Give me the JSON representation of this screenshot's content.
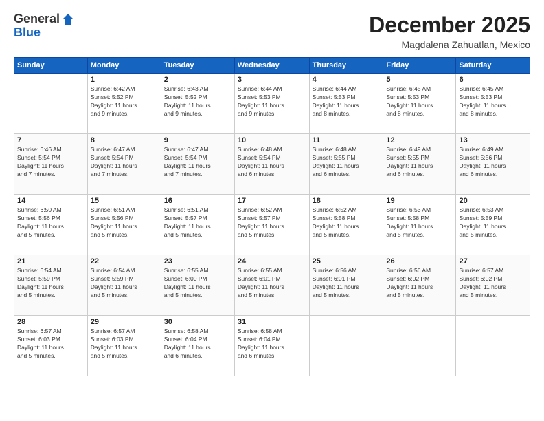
{
  "header": {
    "logo_line1": "General",
    "logo_line2": "Blue",
    "month": "December 2025",
    "location": "Magdalena Zahuatlan, Mexico"
  },
  "columns": [
    "Sunday",
    "Monday",
    "Tuesday",
    "Wednesday",
    "Thursday",
    "Friday",
    "Saturday"
  ],
  "weeks": [
    [
      {
        "day": "",
        "info": ""
      },
      {
        "day": "1",
        "info": "Sunrise: 6:42 AM\nSunset: 5:52 PM\nDaylight: 11 hours\nand 9 minutes."
      },
      {
        "day": "2",
        "info": "Sunrise: 6:43 AM\nSunset: 5:52 PM\nDaylight: 11 hours\nand 9 minutes."
      },
      {
        "day": "3",
        "info": "Sunrise: 6:44 AM\nSunset: 5:53 PM\nDaylight: 11 hours\nand 9 minutes."
      },
      {
        "day": "4",
        "info": "Sunrise: 6:44 AM\nSunset: 5:53 PM\nDaylight: 11 hours\nand 8 minutes."
      },
      {
        "day": "5",
        "info": "Sunrise: 6:45 AM\nSunset: 5:53 PM\nDaylight: 11 hours\nand 8 minutes."
      },
      {
        "day": "6",
        "info": "Sunrise: 6:45 AM\nSunset: 5:53 PM\nDaylight: 11 hours\nand 8 minutes."
      }
    ],
    [
      {
        "day": "7",
        "info": "Sunrise: 6:46 AM\nSunset: 5:54 PM\nDaylight: 11 hours\nand 7 minutes."
      },
      {
        "day": "8",
        "info": "Sunrise: 6:47 AM\nSunset: 5:54 PM\nDaylight: 11 hours\nand 7 minutes."
      },
      {
        "day": "9",
        "info": "Sunrise: 6:47 AM\nSunset: 5:54 PM\nDaylight: 11 hours\nand 7 minutes."
      },
      {
        "day": "10",
        "info": "Sunrise: 6:48 AM\nSunset: 5:54 PM\nDaylight: 11 hours\nand 6 minutes."
      },
      {
        "day": "11",
        "info": "Sunrise: 6:48 AM\nSunset: 5:55 PM\nDaylight: 11 hours\nand 6 minutes."
      },
      {
        "day": "12",
        "info": "Sunrise: 6:49 AM\nSunset: 5:55 PM\nDaylight: 11 hours\nand 6 minutes."
      },
      {
        "day": "13",
        "info": "Sunrise: 6:49 AM\nSunset: 5:56 PM\nDaylight: 11 hours\nand 6 minutes."
      }
    ],
    [
      {
        "day": "14",
        "info": "Sunrise: 6:50 AM\nSunset: 5:56 PM\nDaylight: 11 hours\nand 5 minutes."
      },
      {
        "day": "15",
        "info": "Sunrise: 6:51 AM\nSunset: 5:56 PM\nDaylight: 11 hours\nand 5 minutes."
      },
      {
        "day": "16",
        "info": "Sunrise: 6:51 AM\nSunset: 5:57 PM\nDaylight: 11 hours\nand 5 minutes."
      },
      {
        "day": "17",
        "info": "Sunrise: 6:52 AM\nSunset: 5:57 PM\nDaylight: 11 hours\nand 5 minutes."
      },
      {
        "day": "18",
        "info": "Sunrise: 6:52 AM\nSunset: 5:58 PM\nDaylight: 11 hours\nand 5 minutes."
      },
      {
        "day": "19",
        "info": "Sunrise: 6:53 AM\nSunset: 5:58 PM\nDaylight: 11 hours\nand 5 minutes."
      },
      {
        "day": "20",
        "info": "Sunrise: 6:53 AM\nSunset: 5:59 PM\nDaylight: 11 hours\nand 5 minutes."
      }
    ],
    [
      {
        "day": "21",
        "info": "Sunrise: 6:54 AM\nSunset: 5:59 PM\nDaylight: 11 hours\nand 5 minutes."
      },
      {
        "day": "22",
        "info": "Sunrise: 6:54 AM\nSunset: 5:59 PM\nDaylight: 11 hours\nand 5 minutes."
      },
      {
        "day": "23",
        "info": "Sunrise: 6:55 AM\nSunset: 6:00 PM\nDaylight: 11 hours\nand 5 minutes."
      },
      {
        "day": "24",
        "info": "Sunrise: 6:55 AM\nSunset: 6:01 PM\nDaylight: 11 hours\nand 5 minutes."
      },
      {
        "day": "25",
        "info": "Sunrise: 6:56 AM\nSunset: 6:01 PM\nDaylight: 11 hours\nand 5 minutes."
      },
      {
        "day": "26",
        "info": "Sunrise: 6:56 AM\nSunset: 6:02 PM\nDaylight: 11 hours\nand 5 minutes."
      },
      {
        "day": "27",
        "info": "Sunrise: 6:57 AM\nSunset: 6:02 PM\nDaylight: 11 hours\nand 5 minutes."
      }
    ],
    [
      {
        "day": "28",
        "info": "Sunrise: 6:57 AM\nSunset: 6:03 PM\nDaylight: 11 hours\nand 5 minutes."
      },
      {
        "day": "29",
        "info": "Sunrise: 6:57 AM\nSunset: 6:03 PM\nDaylight: 11 hours\nand 5 minutes."
      },
      {
        "day": "30",
        "info": "Sunrise: 6:58 AM\nSunset: 6:04 PM\nDaylight: 11 hours\nand 6 minutes."
      },
      {
        "day": "31",
        "info": "Sunrise: 6:58 AM\nSunset: 6:04 PM\nDaylight: 11 hours\nand 6 minutes."
      },
      {
        "day": "",
        "info": ""
      },
      {
        "day": "",
        "info": ""
      },
      {
        "day": "",
        "info": ""
      }
    ]
  ]
}
